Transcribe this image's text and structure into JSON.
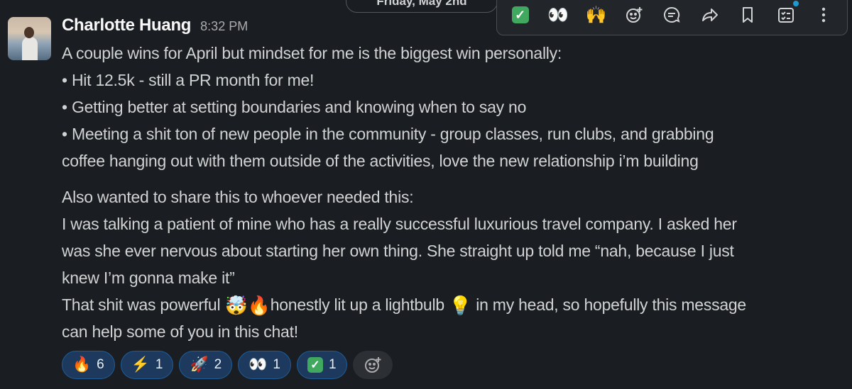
{
  "date_divider": "Friday, May 2nd",
  "toolbar": {
    "quick_reactions": [
      "✅",
      "👀",
      "🙌"
    ],
    "actions": [
      "add-reaction",
      "reply-in-thread",
      "share",
      "save",
      "more-tasks",
      "more"
    ]
  },
  "message": {
    "author": "Charlotte Huang",
    "time": "8:32 PM",
    "lines": [
      "A couple wins for April but mindset for me is the biggest win personally:",
      "• Hit 12.5k - still a PR month for me!",
      "• Getting better at setting boundaries and knowing when to say no",
      "• Meeting a shit ton of new people in the community - group classes, run clubs, and grabbing",
      "coffee hanging out with them outside of the activities, love the new relationship i’m building"
    ],
    "lines2": [
      "Also wanted to share this to whoever needed this:",
      "I was talking a patient of mine who has a really successful luxurious travel company. I asked her",
      "was she ever nervous about starting her own thing. She straight up told me “nah, because I just",
      "knew I’m gonna make it”"
    ],
    "final_part1": "That shit was powerful ",
    "final_emoji1": "🤯",
    "final_emoji2": "🔥",
    "final_part2": "honestly lit up a lightbulb ",
    "final_emoji3": "💡",
    "final_part3": " in my head, so hopefully this message",
    "final_line2": "can help some of you in this chat!"
  },
  "reactions": [
    {
      "emoji": "🔥",
      "count": "6"
    },
    {
      "emoji": "⚡",
      "count": "1"
    },
    {
      "emoji": "🚀",
      "count": "2"
    },
    {
      "emoji": "👀",
      "count": "1"
    },
    {
      "emoji": "✅",
      "count": "1"
    }
  ],
  "colors": {
    "background": "#1a1d21",
    "reaction_bg": "#1d3a5e",
    "reaction_border": "#1d5d97"
  }
}
